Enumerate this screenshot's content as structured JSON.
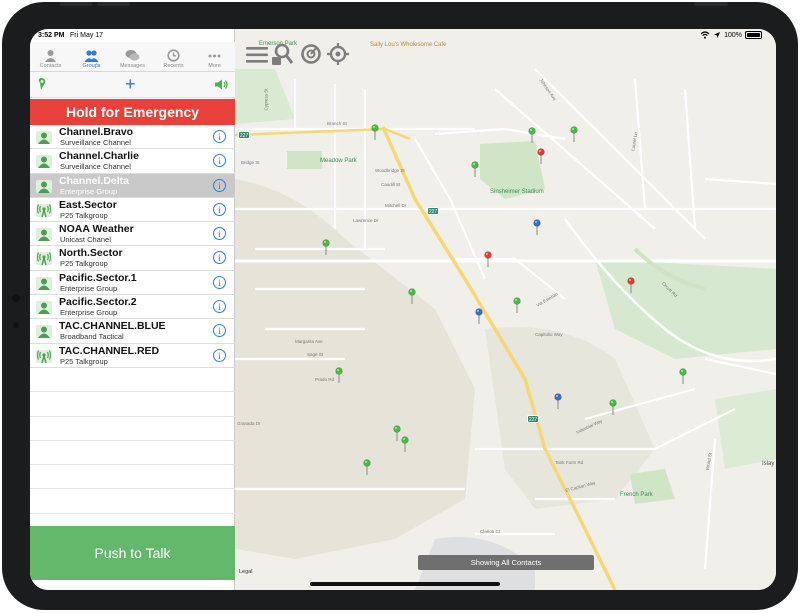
{
  "status": {
    "time": "3:52 PM",
    "date": "Fri May 17",
    "battery": "100%"
  },
  "tabs": [
    {
      "label": "Contacts",
      "icon": "contacts-icon"
    },
    {
      "label": "Groups",
      "icon": "groups-icon"
    },
    {
      "label": "Messages",
      "icon": "messages-icon"
    },
    {
      "label": "Recents",
      "icon": "recents-icon"
    },
    {
      "label": "More",
      "icon": "more-icon"
    }
  ],
  "emergency_label": "Hold for Emergency",
  "ptt_label": "Push to Talk",
  "channels": [
    {
      "name": "Channel.Bravo",
      "sub": "Surveillance Channel",
      "icon": "group-people-icon"
    },
    {
      "name": "Channel.Charlie",
      "sub": "Surveillance Channel",
      "icon": "group-people-icon"
    },
    {
      "name": "Channel.Delta",
      "sub": "Enterprise Group",
      "icon": "group-people-icon"
    },
    {
      "name": "East.Sector",
      "sub": "P25 Talkgroup",
      "icon": "radio-tower-icon"
    },
    {
      "name": "NOAA Weather",
      "sub": "Unicast Chanel",
      "icon": "group-people-icon"
    },
    {
      "name": "North.Sector",
      "sub": "P25 Talkgroup",
      "icon": "radio-tower-icon"
    },
    {
      "name": "Pacific.Sector.1",
      "sub": "Enterprise Group",
      "icon": "group-people-icon"
    },
    {
      "name": "Pacific.Sector.2",
      "sub": "Enterprise Group",
      "icon": "group-people-icon"
    },
    {
      "name": "TAC.CHANNEL.BLUE",
      "sub": "Broadband Tactical",
      "icon": "group-people-icon"
    },
    {
      "name": "TAC.CHANNEL.RED",
      "sub": "P25 Talkgroup",
      "icon": "radio-tower-icon"
    }
  ],
  "selected_channel": "Channel.Delta",
  "map": {
    "toast": "Showing All Contacts",
    "legal": "Legal",
    "pois": [
      "Emerson Park",
      "Sally Lou's Wholesome Cafe",
      "Meadow Park",
      "Sinsheimer Stadium",
      "French Park"
    ],
    "streets": [
      "Johnson Ave",
      "Cypress St",
      "Branch St",
      "Bridge St",
      "Woodbridge St",
      "Caudill St",
      "Mitchell Dr",
      "Lawrence Dr",
      "Orcutt Rd",
      "Tank Farm Rd",
      "El Capitan Way",
      "Industrial Way",
      "Via Esteban",
      "Capitolio Way",
      "Prado Rd",
      "Granada Dr",
      "Margarita Ave",
      "Sage St",
      "Clarion Ct",
      "Broad St",
      "Laurel Ln",
      "Islay"
    ],
    "route_shields": [
      "227",
      "227",
      "227"
    ],
    "colors": {
      "green": "#3fbf3f",
      "red": "#e53a32",
      "blue": "#2f6fd1"
    }
  }
}
